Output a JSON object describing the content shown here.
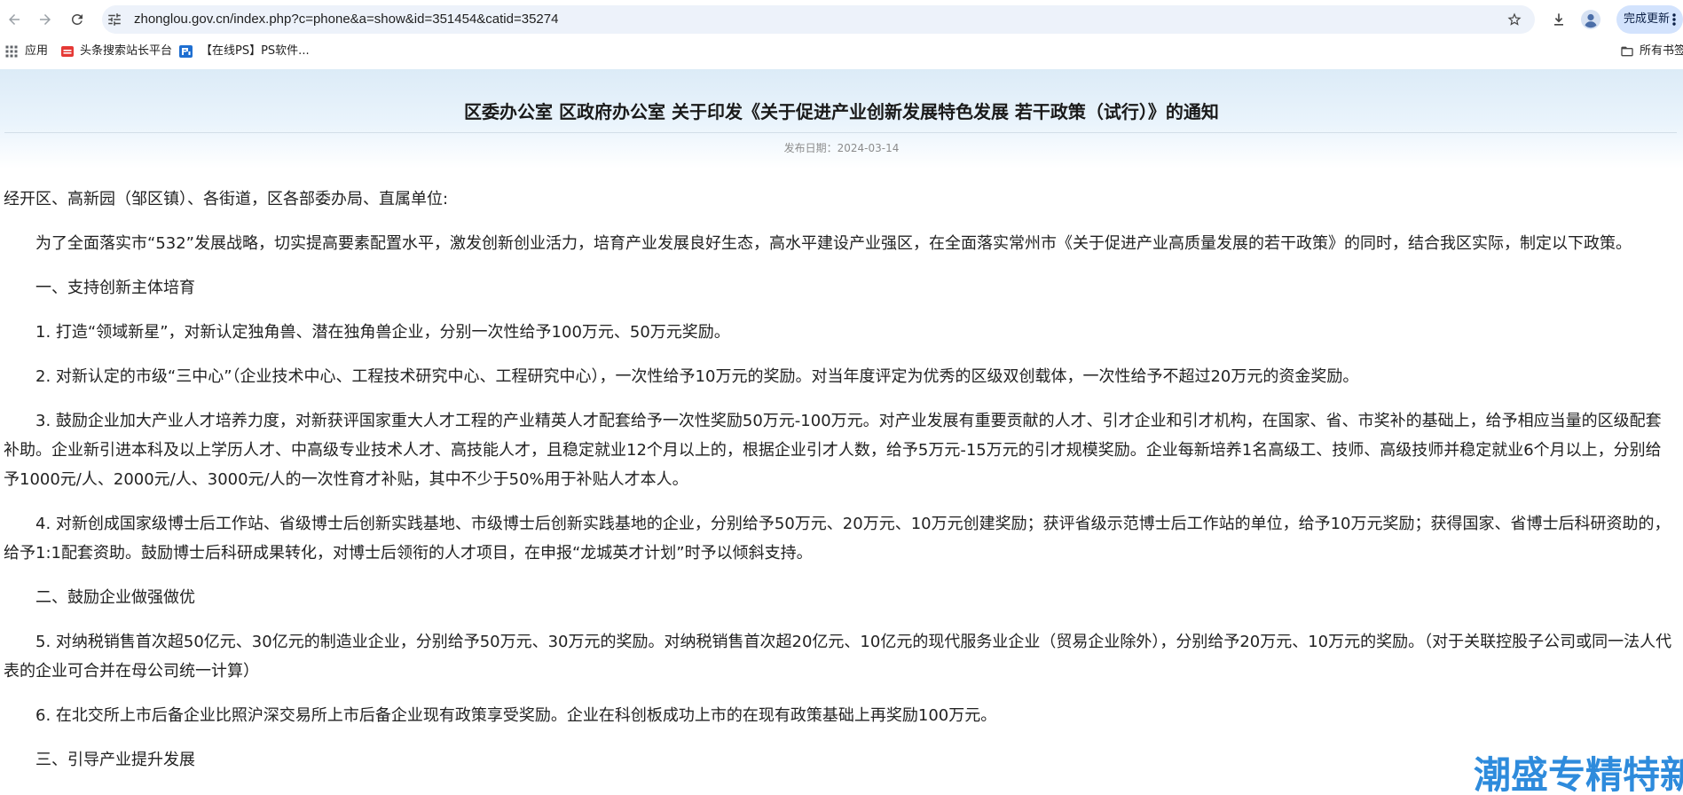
{
  "browser": {
    "url": "zhonglou.gov.cn/index.php?c=phone&a=show&id=351454&catid=35274",
    "update_button": "完成更新",
    "bookmarks": [
      {
        "label": "应用",
        "icon": "apps-grid-icon"
      },
      {
        "label": "头条搜索站长平台",
        "icon": "toutiao-favicon-icon"
      },
      {
        "label": "【在线PS】PS软件...",
        "icon": "online-ps-favicon-icon"
      }
    ],
    "all_bookmarks": "所有书签",
    "toolbar_icons": [
      "back-arrow-icon",
      "forward-arrow-icon",
      "reload-icon",
      "site-settings-icon",
      "bookmark-star-icon",
      "download-icon",
      "profile-icon",
      "more-vert-icon",
      "folder-icon"
    ]
  },
  "article": {
    "title": "区委办公室 区政府办公室 关于印发《关于促进产业创新发展特色发展 若干政策（试行）》的通知",
    "publish_date": "发布日期：2024-03-14",
    "paragraphs": [
      "经开区、高新园（邹区镇）、各街道，区各部委办局、直属单位:",
      "为了全面落实市“532”发展战略，切实提高要素配置水平，激发创新创业活力，培育产业发展良好生态，高水平建设产业强区，在全面落实常州市《关于促进产业高质量发展的若干政策》的同时，结合我区实际，制定以下政策。",
      "一、支持创新主体培育",
      "1. 打造“领域新星”，对新认定独角兽、潜在独角兽企业，分别一次性给予100万元、50万元奖励。",
      "2. 对新认定的市级“三中心”（企业技术中心、工程技术研究中心、工程研究中心），一次性给予10万元的奖励。对当年度评定为优秀的区级双创载体，一次性给予不超过20万元的资金奖励。",
      "3. 鼓励企业加大产业人才培养力度，对新获评国家重大人才工程的产业精英人才配套给予一次性奖励50万元-100万元。对产业发展有重要贡献的人才、引才企业和引才机构，在国家、省、市奖补的基础上，给予相应当量的区级配套补助。企业新引进本科及以上学历人才、中高级专业技术人才、高技能人才，且稳定就业12个月以上的，根据企业引才人数，给予5万元-15万元的引才规模奖励。企业每新培养1名高级工、技师、高级技师并稳定就业6个月以上，分别给予1000元/人、2000元/人、3000元/人的一次性育才补贴，其中不少于50%用于补贴人才本人。",
      "4. 对新创成国家级博士后工作站、省级博士后创新实践基地、市级博士后创新实践基地的企业，分别给予50万元、20万元、10万元创建奖励；获评省级示范博士后工作站的单位，给予10万元奖励；获得国家、省博士后科研资助的，给予1:1配套资助。鼓励博士后科研成果转化，对博士后领衔的人才项目，在申报“龙城英才计划”时予以倾斜支持。",
      "二、鼓励企业做强做优",
      "5. 对纳税销售首次超50亿元、30亿元的制造业企业，分别给予50万元、30万元的奖励。对纳税销售首次超20亿元、10亿元的现代服务业企业（贸易企业除外），分别给予20万元、10万元的奖励。（对于关联控股子公司或同一法人代表的企业可合并在母公司统一计算）",
      "6. 在北交所上市后备企业比照沪深交易所上市后备企业现有政策享受奖励。企业在科创板成功上市的在现有政策基础上再奖励100万元。",
      "三、引导产业提升发展"
    ]
  },
  "watermark": "潮盛专精特新",
  "colors": {
    "body_text": "#222222",
    "header_tint": "#dcebf7",
    "omnibox_bg": "#edf2fa",
    "update_pill": "#d3e3fd",
    "watermark": "#2e8bdc"
  }
}
